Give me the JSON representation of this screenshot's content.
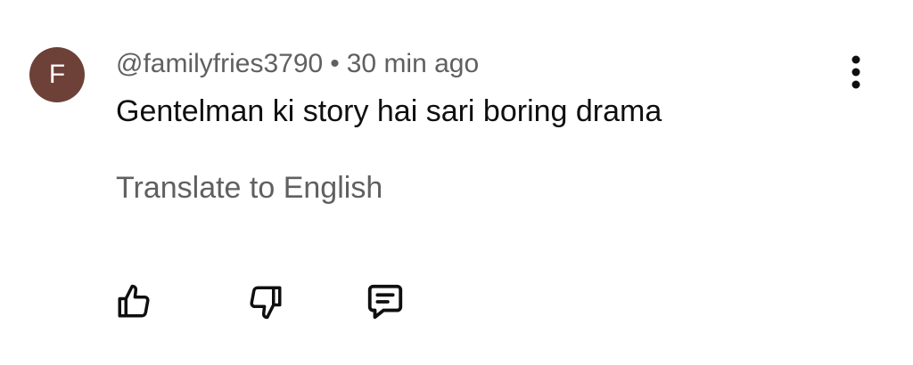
{
  "comment": {
    "avatar_letter": "F",
    "avatar_color": "#6d4137",
    "author": "@familyfries3790",
    "separator": "•",
    "timestamp": "30 min ago",
    "text": "Gentelman ki story hai sari boring drama",
    "translate_label": "Translate to English"
  },
  "actions": {
    "like_icon": "thumbs-up-icon",
    "dislike_icon": "thumbs-down-icon",
    "reply_icon": "reply-comment-icon",
    "menu_icon": "more-vert-icon"
  }
}
